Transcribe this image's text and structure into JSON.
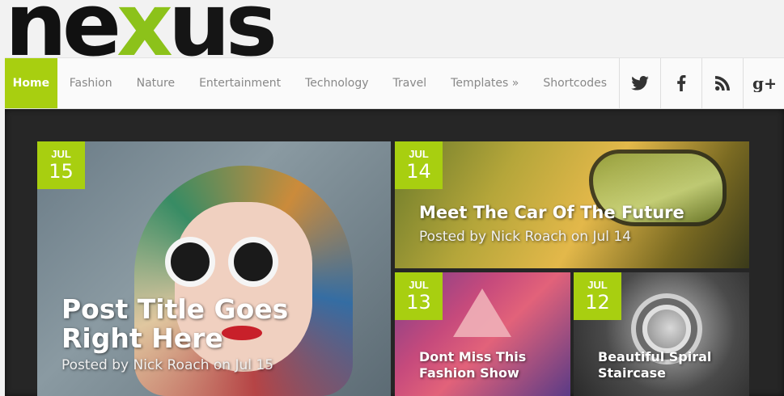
{
  "logo": {
    "part1": "ne",
    "part2": "x",
    "part3": "us"
  },
  "nav": {
    "items": [
      "Home",
      "Fashion",
      "Nature",
      "Entertainment",
      "Technology",
      "Travel",
      "Templates »",
      "Shortcodes"
    ],
    "active_index": 0
  },
  "social": [
    {
      "name": "twitter-icon",
      "glyph": "🐦"
    },
    {
      "name": "facebook-icon",
      "glyph": "f"
    },
    {
      "name": "rss-icon",
      "glyph": ")"
    },
    {
      "name": "google-plus-icon",
      "glyph": "g+"
    }
  ],
  "colors": {
    "accent": "#a8cf10",
    "dark": "#262626"
  },
  "posts": [
    {
      "month": "JUL",
      "day": "15",
      "title": "Post Title Goes Right Here",
      "meta": "Posted by Nick Roach on Jul 15"
    },
    {
      "month": "JUL",
      "day": "14",
      "title": "Meet The Car Of The Future",
      "meta": "Posted by Nick Roach on Jul 14"
    },
    {
      "month": "JUL",
      "day": "13",
      "title": "Dont Miss This Fashion Show"
    },
    {
      "month": "JUL",
      "day": "12",
      "title": "Beautiful Spiral Staircase"
    }
  ]
}
